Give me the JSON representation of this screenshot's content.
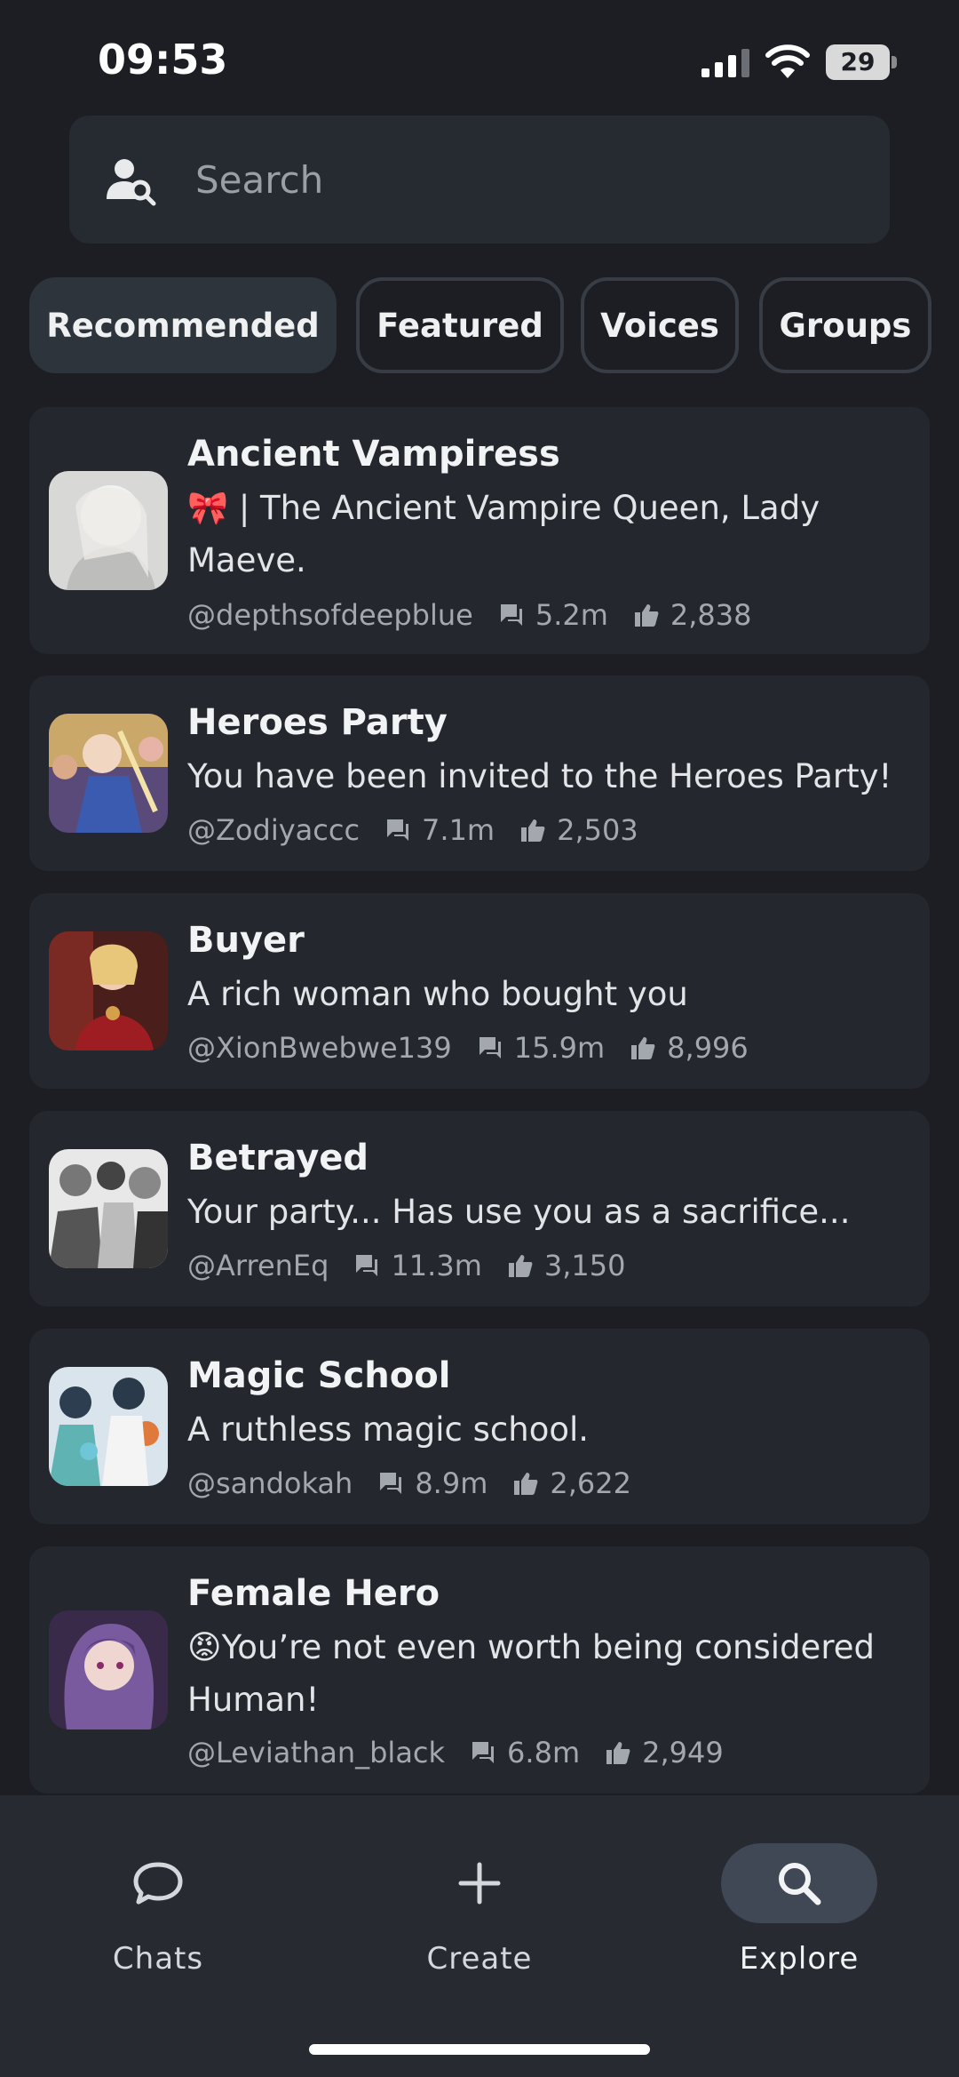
{
  "status_bar": {
    "time": "09:53",
    "battery": "29"
  },
  "search": {
    "placeholder": "Search"
  },
  "tabs": [
    {
      "label": "Recommended",
      "active": true
    },
    {
      "label": "Featured",
      "active": false
    },
    {
      "label": "Voices",
      "active": false
    },
    {
      "label": "Groups",
      "active": false
    }
  ],
  "characters": [
    {
      "title": "Ancient Vampiress",
      "description": "🎀 | The Ancient Vampire Queen, Lady Maeve.",
      "author": "@depthsofdeepblue",
      "chats": "5.2m",
      "likes": "2,838"
    },
    {
      "title": "Heroes Party",
      "description": "You have been invited to the Heroes Party!",
      "author": "@Zodiyaccc",
      "chats": "7.1m",
      "likes": "2,503"
    },
    {
      "title": "Buyer",
      "description": "A rich woman who bought you",
      "author": "@XionBwebwe139",
      "chats": "15.9m",
      "likes": "8,996"
    },
    {
      "title": "Betrayed",
      "description": "Your party... Has use you as a sacrifice...",
      "author": "@ArrenEq",
      "chats": "11.3m",
      "likes": "3,150"
    },
    {
      "title": "Magic School",
      "description": "A ruthless magic school.",
      "author": "@sandokah",
      "chats": "8.9m",
      "likes": "2,622"
    },
    {
      "title": "Female Hero",
      "description": "😡You’re not even worth being considered Human!",
      "author": "@Leviathan_black",
      "chats": "6.8m",
      "likes": "2,949"
    }
  ],
  "bottom_nav": [
    {
      "label": "Chats",
      "icon": "chat-bubble-icon",
      "active": false
    },
    {
      "label": "Create",
      "icon": "plus-icon",
      "active": false
    },
    {
      "label": "Explore",
      "icon": "search-icon",
      "active": true
    }
  ],
  "colors": {
    "background": "#1c1e23",
    "card": "#24272d",
    "accent_active": "#3f4854"
  }
}
